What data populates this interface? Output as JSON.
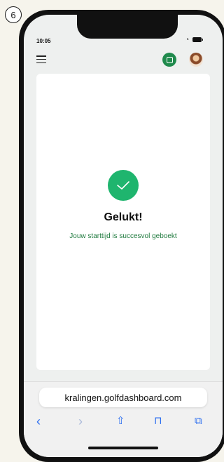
{
  "step": {
    "number": "6"
  },
  "status": {
    "time": "10:05"
  },
  "success": {
    "title": "Gelukt!",
    "message": "Jouw starttijd is succesvol geboekt"
  },
  "browser": {
    "url": "kralingen.golfdashboard.com",
    "back_icon": "chevron-left",
    "forward_icon": "chevron-right",
    "share_icon": "share",
    "bookmarks_icon": "book",
    "tabs_icon": "tabs"
  },
  "colors": {
    "accent_green": "#1fb56e",
    "text_green": "#1f7a3e",
    "link_blue": "#2a6df0"
  }
}
